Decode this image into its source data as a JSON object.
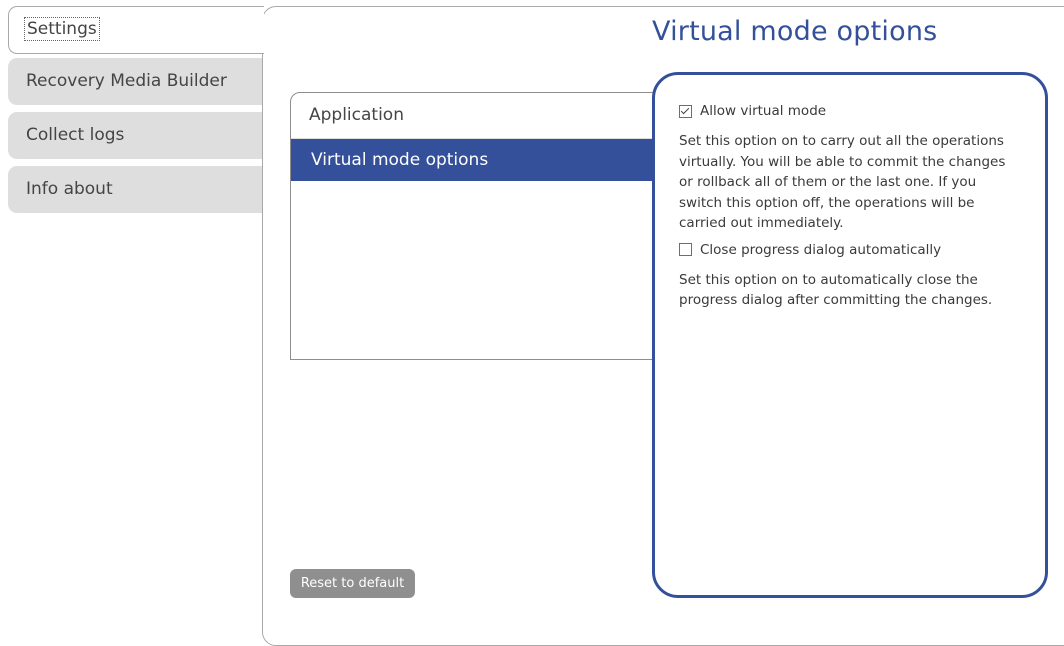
{
  "tabs": [
    {
      "label": "Settings",
      "active": true
    },
    {
      "label": "Recovery Media Builder",
      "active": false
    },
    {
      "label": "Collect logs",
      "active": false
    },
    {
      "label": "Info about",
      "active": false
    }
  ],
  "page_title": "Virtual mode options",
  "categories": {
    "header": "Application",
    "items": [
      {
        "label": "Virtual mode options",
        "selected": true
      }
    ]
  },
  "options": [
    {
      "label": "Allow virtual mode",
      "checked": true,
      "description": "Set this option on to carry out all the operations virtually. You will be able to commit the changes or rollback all of them or the last one. If you switch this option off, the operations will be carried out immediately."
    },
    {
      "label": "Close progress dialog automatically",
      "checked": false,
      "description": "Set this option on to automatically close the progress dialog after committing the changes."
    }
  ],
  "reset_button": "Reset to default",
  "colors": {
    "accent": "#34509a",
    "tab_bg": "#dedede",
    "button_bg": "#8f8f8f"
  }
}
